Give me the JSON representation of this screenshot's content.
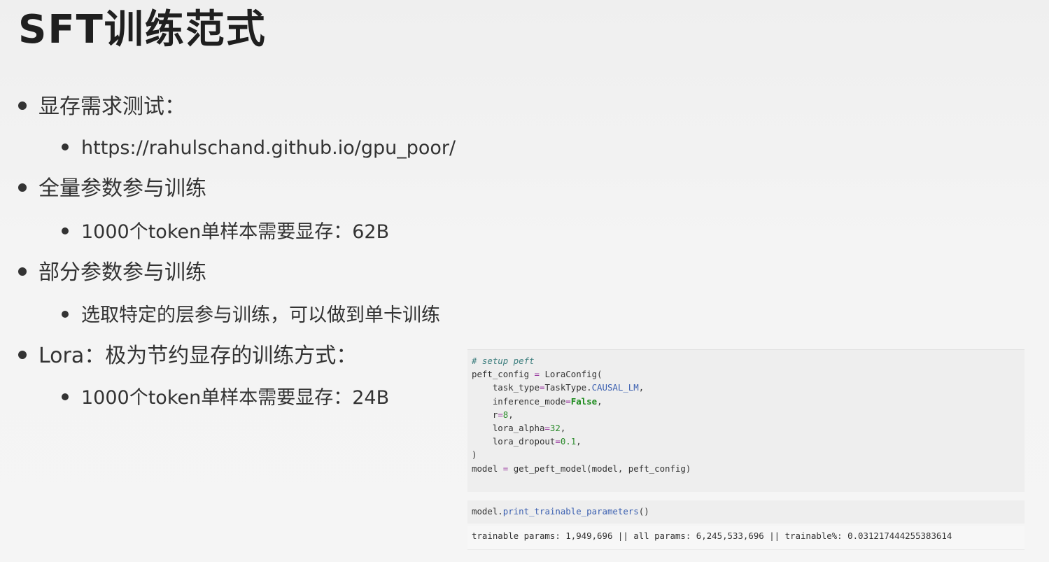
{
  "title": "SFT训练范式",
  "bullets": [
    {
      "level": 1,
      "text": "显存需求测试："
    },
    {
      "level": 2,
      "text": "https://rahulschand.github.io/gpu_poor/"
    },
    {
      "level": 1,
      "text": "全量参数参与训练"
    },
    {
      "level": 2,
      "text": "1000个token单样本需要显存：62B"
    },
    {
      "level": 1,
      "text": "部分参数参与训练"
    },
    {
      "level": 2,
      "text": "选取特定的层参与训练，可以做到单卡训练"
    },
    {
      "level": 1,
      "text": "Lora：极为节约显存的训练方式："
    },
    {
      "level": 2,
      "text": "1000个token单样本需要显存：24B"
    }
  ],
  "code": {
    "comment": "# setup peft",
    "line1_a": "peft_config ",
    "line1_op": "=",
    "line1_b": " LoraConfig(",
    "task_type_key": "    task_type",
    "task_type_val_a": "TaskType.",
    "task_type_val_b": "CAUSAL_LM",
    "inference_key": "    inference_mode",
    "inference_val": "False",
    "r_key": "    r",
    "r_val": "8",
    "alpha_key": "    lora_alpha",
    "alpha_val": "32",
    "dropout_key": "    lora_dropout",
    "dropout_val": "0.1",
    "close": ")",
    "model_line_a": "model ",
    "model_line_op": "=",
    "model_line_b": " get_peft_model(model, peft_config)",
    "print_a": "model.",
    "print_b": "print_trainable_parameters",
    "print_c": "()",
    "output": "trainable params: 1,949,696 || all params: 6,245,533,696 || trainable%: 0.031217444255383614"
  }
}
